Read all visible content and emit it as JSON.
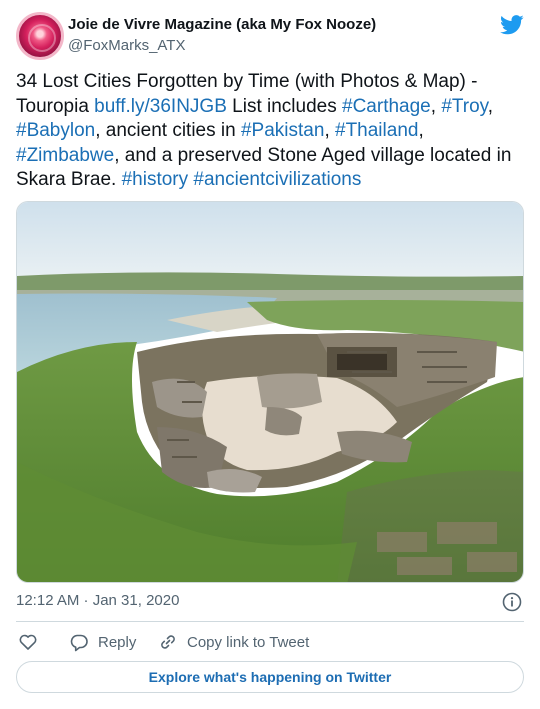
{
  "author": {
    "name": "Joie de Vivre Magazine (aka My Fox Nooze)",
    "handle": "@FoxMarks_ATX"
  },
  "tweet": {
    "t1": "34 Lost Cities Forgotten by Time (with Photos & Map) - Touropia ",
    "link": "buff.ly/36INJGB",
    "t2": "  List includes ",
    "tag_carthage": "#Carthage",
    "t3": ", ",
    "tag_troy": "#Troy",
    "t4": ", ",
    "tag_babylon": "#Babylon",
    "t5": ", ancient cities in ",
    "tag_pakistan": "#Pakistan",
    "t6": ", ",
    "tag_thailand": "#Thailand",
    "t7": ", ",
    "tag_zimbabwe": "#Zimbabwe",
    "t8": ", and a preserved Stone Aged village located in Skara Brae.  ",
    "tag_history": "#history",
    "t9": " ",
    "tag_ancient": "#ancientcivilizations"
  },
  "timestamp": "12:12 AM · Jan 31, 2020",
  "actions": {
    "reply": "Reply",
    "copy": "Copy link to Tweet"
  },
  "explore_label": "Explore what's happening on Twitter",
  "colors": {
    "link": "#1b6fb5",
    "twitter_blue": "#1d9bf0",
    "muted": "#536471"
  },
  "icons": [
    "twitter-bird-icon",
    "info-icon",
    "heart-icon",
    "reply-icon",
    "link-icon"
  ]
}
